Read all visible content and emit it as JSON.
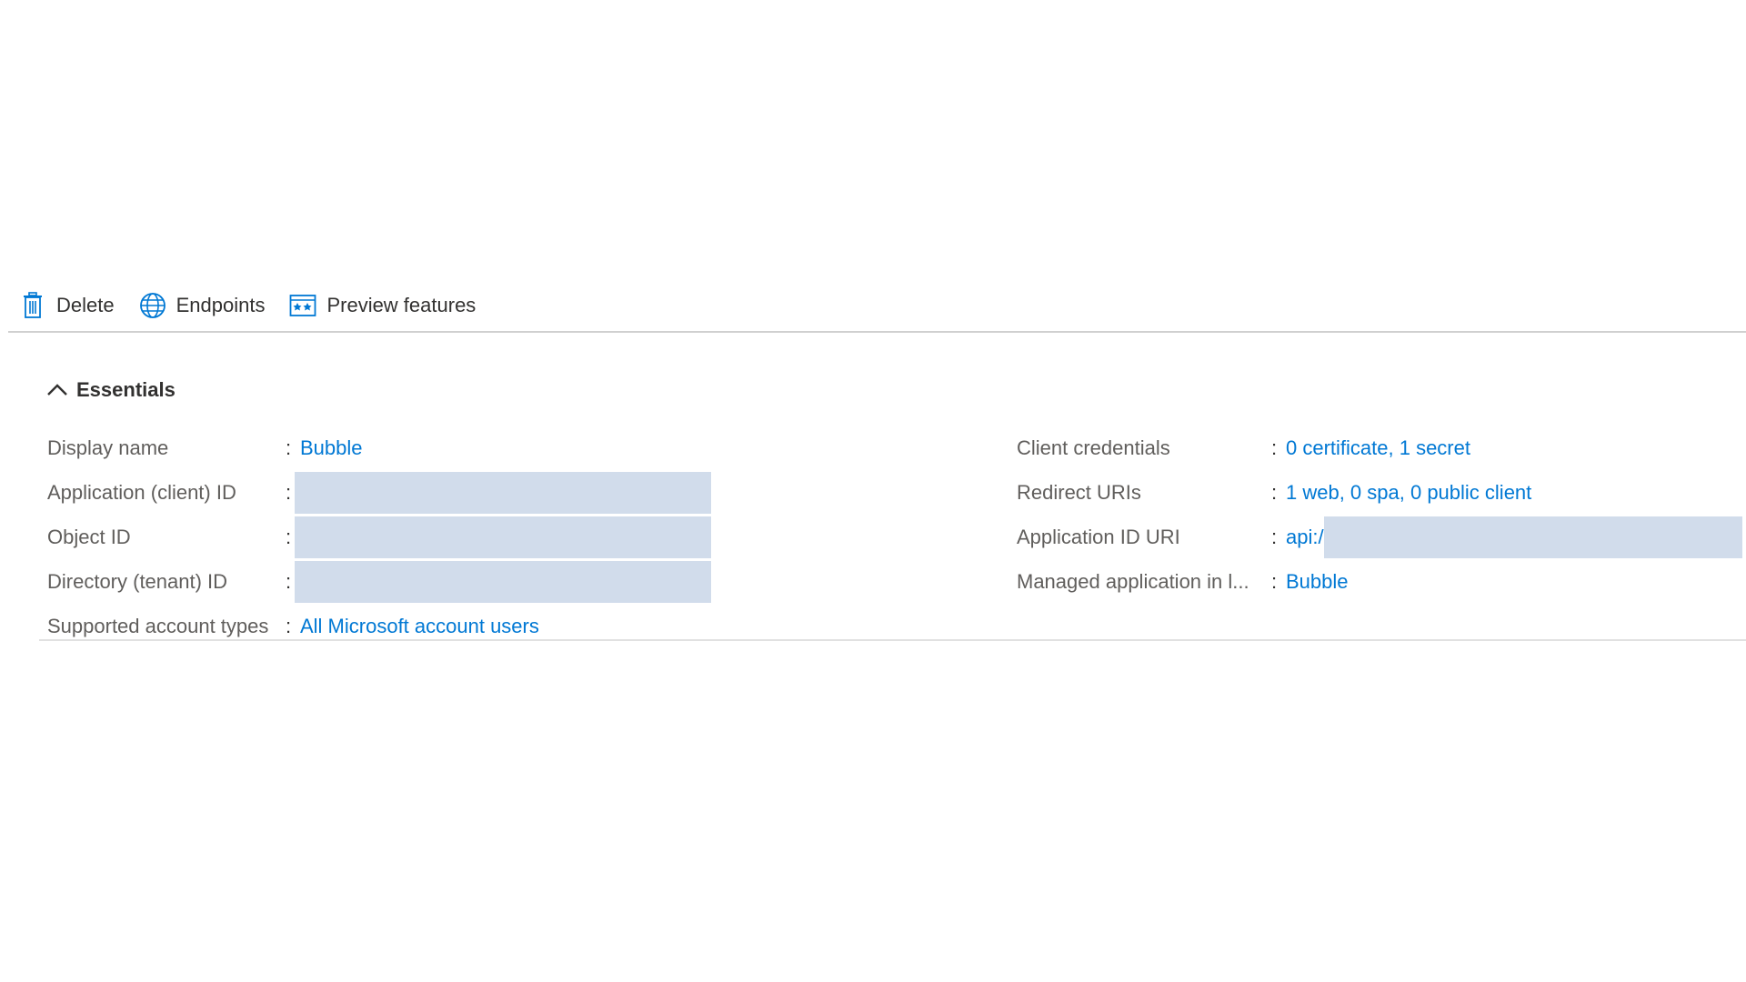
{
  "toolbar": {
    "delete_label": "Delete",
    "endpoints_label": "Endpoints",
    "preview_label": "Preview features"
  },
  "essentials": {
    "title": "Essentials",
    "left": [
      {
        "key": "Display name",
        "value": "Bubble"
      },
      {
        "key": "Application (client) ID",
        "value": ""
      },
      {
        "key": "Object ID",
        "value": ""
      },
      {
        "key": "Directory (tenant) ID",
        "value": ""
      },
      {
        "key": "Supported account types",
        "value": "All Microsoft account users"
      }
    ],
    "right": [
      {
        "key": "Client credentials",
        "value": "0 certificate, 1 secret"
      },
      {
        "key": "Redirect URIs",
        "value": "1 web, 0 spa, 0 public client"
      },
      {
        "key": "Application ID URI",
        "value": "api:/"
      },
      {
        "key": "Managed application in l...",
        "value": "Bubble"
      }
    ],
    "separator": ":"
  },
  "colors": {
    "link": "#0078d4",
    "redacted": "#d1dceb",
    "icon": "#0078d4"
  },
  "icons": {
    "delete": "trash-icon",
    "endpoints": "globe-icon",
    "preview": "preview-features-icon",
    "collapse": "chevron-up-icon"
  }
}
